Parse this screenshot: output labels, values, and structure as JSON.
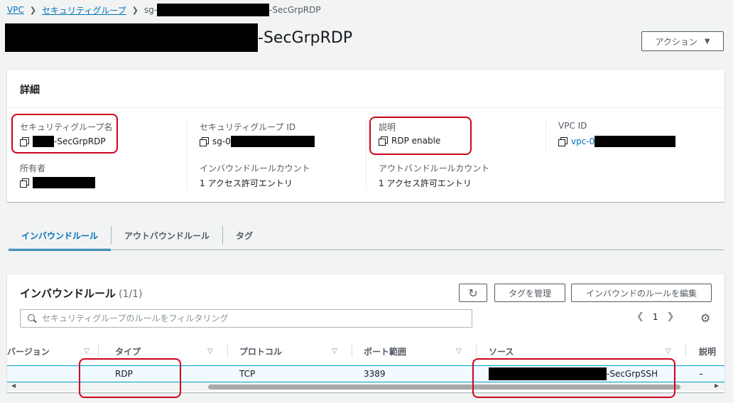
{
  "breadcrumb": {
    "vpc": "VPC",
    "security_groups": "セキュリティグループ",
    "current_prefix": "sg-",
    "current_suffix": "-SecGrpRDP"
  },
  "page": {
    "title_suffix": "-SecGrpRDP"
  },
  "actions_button": {
    "label": "アクション",
    "caret": "▼"
  },
  "details": {
    "heading": "詳細",
    "sg_name_label": "セキュリティグループ名",
    "sg_name_value": "-SecGrpRDP",
    "sg_id_label": "セキュリティグループ ID",
    "sg_id_value": "sg-0",
    "description_label": "説明",
    "description_value": "RDP enable",
    "vpc_id_label": "VPC ID",
    "vpc_id_value": "vpc-0",
    "owner_label": "所有者",
    "inbound_count_label": "インバウンドルールカウント",
    "inbound_count_value": "1 アクセス許可エントリ",
    "outbound_count_label": "アウトバンドルールカウント",
    "outbound_count_value": "1 アクセス許可エントリ"
  },
  "tabs": [
    "インバウンドルール",
    "アウトバウンドルール",
    "タグ"
  ],
  "rules": {
    "title": "インバウンドルール",
    "count": "(1/1)",
    "refresh_icon": "refresh-icon",
    "manage_tags": "タグを管理",
    "edit_rules": "インバウンドのルールを編集",
    "search_placeholder": "セキュリティグループのルールをフィルタリング",
    "page_number": "1",
    "columns": [
      "バージョン",
      "タイプ",
      "プロトコル",
      "ポート範囲",
      "ソース",
      "説明"
    ],
    "row": {
      "version": "",
      "type": "RDP",
      "protocol": "TCP",
      "port_range": "3389",
      "source_suffix": "-SecGrpSSH",
      "description": "–"
    }
  },
  "colors": {
    "link": "#0073bb",
    "highlight": "#d0021b",
    "redaction": "#000000"
  }
}
